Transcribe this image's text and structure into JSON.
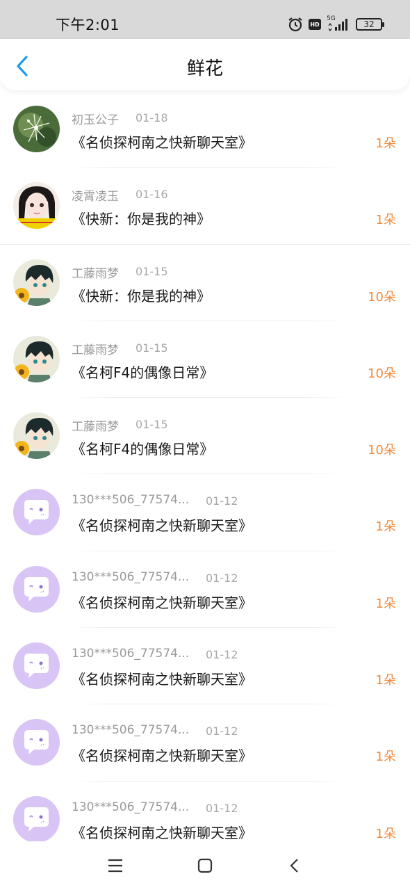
{
  "status": {
    "time": "下午2:01",
    "hd": "HD",
    "network": "5G",
    "battery": "32"
  },
  "header": {
    "title": "鲜花"
  },
  "colors": {
    "accent_blue": "#1a9cf0",
    "amount_orange": "#f08a3c"
  },
  "items": [
    {
      "avatar": "nature-avatar",
      "name": "初玉公子",
      "date": "01-18",
      "book": "《名侦探柯南之快新聊天室》",
      "amount": "1朵"
    },
    {
      "avatar": "girl-avatar",
      "name": "凌霄凌玉",
      "date": "01-16",
      "book": "《快新：你是我的神》",
      "amount": "1朵"
    },
    {
      "avatar": "anime-boy-avatar",
      "name": "工藤雨梦",
      "date": "01-15",
      "book": "《快新：你是我的神》",
      "amount": "10朵"
    },
    {
      "avatar": "anime-boy-avatar",
      "name": "工藤雨梦",
      "date": "01-15",
      "book": "《名柯F4的偶像日常》",
      "amount": "10朵"
    },
    {
      "avatar": "anime-boy-avatar",
      "name": "工藤雨梦",
      "date": "01-15",
      "book": "《名柯F4的偶像日常》",
      "amount": "10朵"
    },
    {
      "avatar": "chat-bubble-avatar",
      "name": "130***506_77574...",
      "date": "01-12",
      "book": "《名侦探柯南之快新聊天室》",
      "amount": "1朵"
    },
    {
      "avatar": "chat-bubble-avatar",
      "name": "130***506_77574...",
      "date": "01-12",
      "book": "《名侦探柯南之快新聊天室》",
      "amount": "1朵"
    },
    {
      "avatar": "chat-bubble-avatar",
      "name": "130***506_77574...",
      "date": "01-12",
      "book": "《名侦探柯南之快新聊天室》",
      "amount": "1朵"
    },
    {
      "avatar": "chat-bubble-avatar",
      "name": "130***506_77574...",
      "date": "01-12",
      "book": "《名侦探柯南之快新聊天室》",
      "amount": "1朵"
    },
    {
      "avatar": "chat-bubble-avatar",
      "name": "130***506_77574...",
      "date": "01-12",
      "book": "《名侦探柯南之快新聊天室》",
      "amount": "1朵"
    }
  ],
  "navbar": {
    "icons": [
      "menu-icon",
      "home-icon",
      "back-icon"
    ]
  }
}
